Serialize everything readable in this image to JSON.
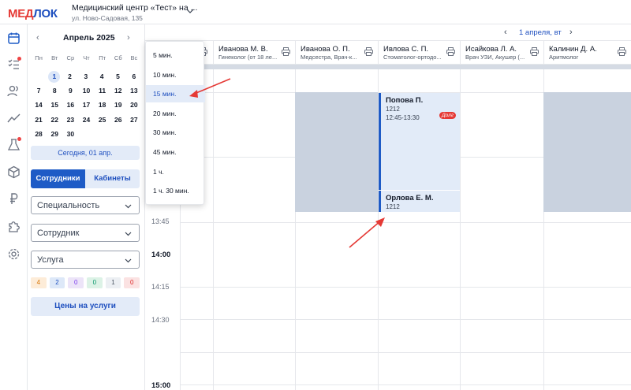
{
  "header": {
    "logo_part1": "МЕД",
    "logo_part2": "ЛОК",
    "clinic_name": "Медицинский центр «Тест» на ...",
    "clinic_address": "ул. Ново-Садовая, 135"
  },
  "iconbar": [
    "calendar-icon",
    "tasks-icon",
    "users-icon",
    "chart-icon",
    "lab-icon",
    "box-icon",
    "ruble-icon",
    "puzzle-icon",
    "settings-icon"
  ],
  "calendar": {
    "prev": "‹",
    "next": "›",
    "title": "Апрель 2025",
    "weekdays": [
      "Пн",
      "Вт",
      "Ср",
      "Чт",
      "Пт",
      "Сб",
      "Вс"
    ],
    "weeks": [
      [
        "",
        "1",
        "2",
        "3",
        "4",
        "5",
        "6"
      ],
      [
        "7",
        "8",
        "9",
        "10",
        "11",
        "12",
        "13"
      ],
      [
        "14",
        "15",
        "16",
        "17",
        "18",
        "19",
        "20"
      ],
      [
        "21",
        "22",
        "23",
        "24",
        "25",
        "26",
        "27"
      ],
      [
        "28",
        "29",
        "30",
        "",
        "",
        "",
        ""
      ]
    ],
    "today_button": "Сегодня, 01 апр."
  },
  "tabs": {
    "staff": "Сотрудники",
    "rooms": "Кабинеты"
  },
  "filters": {
    "specialty": "Специальность",
    "employee": "Сотрудник",
    "service": "Услуга"
  },
  "counters": [
    {
      "value": "4",
      "bg": "#fdecd8",
      "color": "#d97706"
    },
    {
      "value": "2",
      "bg": "#dde8f8",
      "color": "#1e4fbf"
    },
    {
      "value": "0",
      "bg": "#ece4f8",
      "color": "#7c3aed"
    },
    {
      "value": "0",
      "bg": "#dcf2e6",
      "color": "#059669"
    },
    {
      "value": "1",
      "bg": "#eceff3",
      "color": "#4b5563"
    },
    {
      "value": "0",
      "bg": "#fbe2e2",
      "color": "#dc2626"
    }
  ],
  "price_button": "Цены на услуги",
  "date_nav": {
    "prev": "‹",
    "label": "1 апреля, вт",
    "next": "›"
  },
  "columns": [
    {
      "name": "Иванова М. В.",
      "spec": "Гинеколог (от 18 ле..."
    },
    {
      "name": "Иванова О. П.",
      "spec": "Медсестра, Врач-к..."
    },
    {
      "name": "Ивлова С. П.",
      "spec": "Стоматолог-ортодо..."
    },
    {
      "name": "Исайкова Л. А.",
      "spec": "Врач УЗИ, Акушер (..."
    },
    {
      "name": "Калинин Д. А.",
      "spec": "Аритмолог"
    }
  ],
  "times": [
    "13:45",
    "14:00",
    "14:15",
    "14:30",
    "15:00"
  ],
  "appointments": [
    {
      "name": "Попова П.",
      "number": "1212",
      "time": "12:45-13:30",
      "badge": "Долг"
    },
    {
      "name": "Орлова Е. М.",
      "number": "1212",
      "time": "",
      "badge": ""
    }
  ],
  "interval_dropdown": {
    "options": [
      "5 мин.",
      "10 мин.",
      "15 мин.",
      "20 мин.",
      "30 мин.",
      "45 мин.",
      "1 ч.",
      "1 ч. 30 мин."
    ],
    "selected": "15 мин."
  },
  "colors": {
    "accent": "#1e5bc6",
    "brand_red": "#e53935",
    "blocked": "#c9d2df",
    "arrow": "#e53935"
  }
}
